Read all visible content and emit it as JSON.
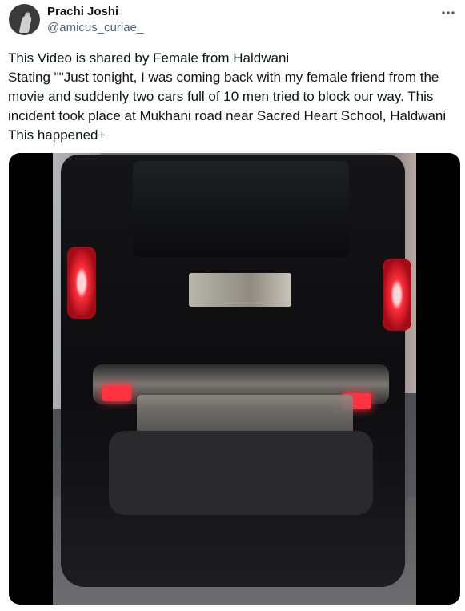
{
  "tweet": {
    "author": {
      "display_name": "Prachi Joshi",
      "handle": "@amicus_curiae_"
    },
    "more_icon": "more-horizontal-icon",
    "text": "This Video is shared by Female from Haldwani\nStating \"\"Just tonight, I was coming back with my female friend from the movie and suddenly two cars full of 10 men tried to block our way. This incident took place at Mukhani road near Sacred Heart School, Haldwani This happened+",
    "media": {
      "type": "video",
      "subject": "rear view of a black SUV with red tail lights at night"
    }
  },
  "colors": {
    "text_primary": "#0f1419",
    "text_secondary": "#536471",
    "background": "#ffffff",
    "media_letterbox": "#000000",
    "tail_light": "#ff2e3c"
  }
}
